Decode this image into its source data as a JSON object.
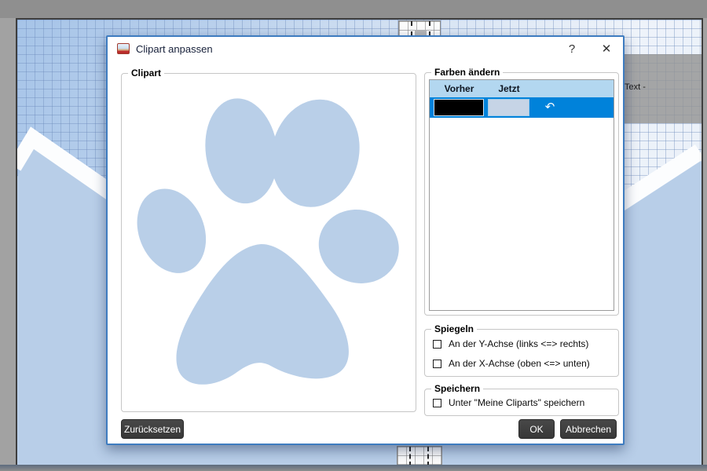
{
  "background": {
    "text_object_label": "Text -",
    "canvas_colors": {
      "grid_line": "#6a88ba",
      "canvas_top": "#a6c4e8",
      "mountain_fill": "#b8cee8",
      "mountain_band": "#fcfdfe",
      "chrome_gray": "#8f8f8f"
    }
  },
  "dialog": {
    "title": "Clipart anpassen",
    "help_label": "?",
    "close_label": "✕",
    "border_color": "#3e7cc0",
    "clipart_group": {
      "label": "Clipart",
      "clipart_name": "paw-print",
      "clipart_color": "#b9cfe8"
    },
    "colors_group": {
      "label": "Farben ändern",
      "table": {
        "headers": [
          "Vorher",
          "Jetzt"
        ],
        "header_bg": "#b3d7f0",
        "selected_row_bg": "#0082da",
        "rows": [
          {
            "before_color": "#000000",
            "after_color": "#c6d4e6",
            "undo_icon": "↶"
          }
        ]
      }
    },
    "mirror_group": {
      "label": "Spiegeln",
      "options": [
        {
          "label": "An der Y-Achse (links <=> rechts)",
          "checked": false
        },
        {
          "label": "An der X-Achse (oben <=> unten)",
          "checked": false
        }
      ]
    },
    "save_group": {
      "label": "Speichern",
      "options": [
        {
          "label": "Unter \"Meine Cliparts\" speichern",
          "checked": false
        }
      ]
    },
    "buttons": {
      "reset": "Zurücksetzen",
      "ok": "OK",
      "cancel": "Abbrechen",
      "button_bg": "#3b3b3b"
    }
  }
}
